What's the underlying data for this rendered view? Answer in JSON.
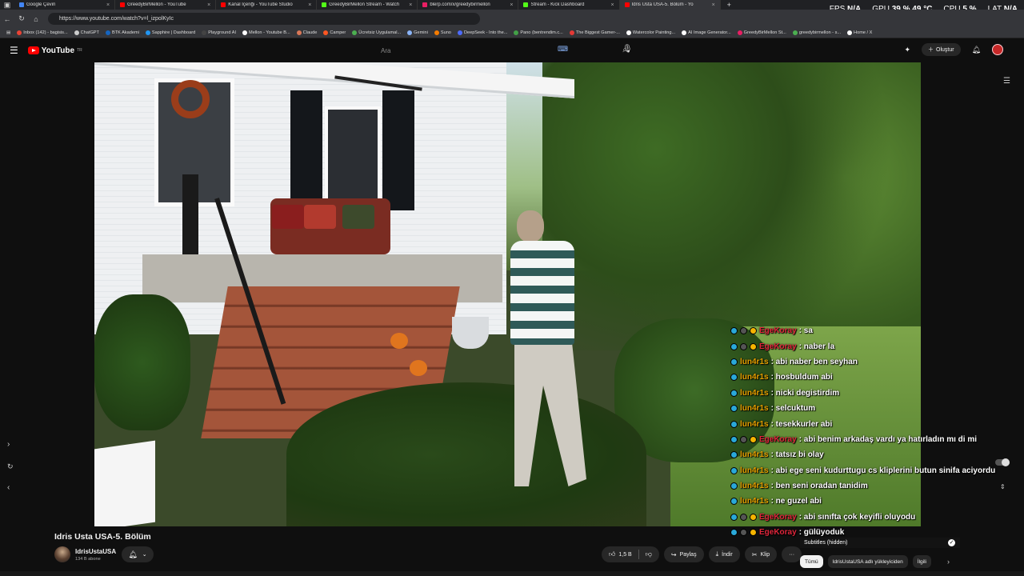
{
  "browser": {
    "tabs": [
      {
        "label": "Google Çeviri",
        "color": "#4285f4"
      },
      {
        "label": "GreedyBirMellon - YouTube",
        "color": "#ff0000"
      },
      {
        "label": "Kanal İçeriği - YouTube Studio",
        "color": "#ff0000"
      },
      {
        "label": "GreedyBirMellon Stream - Watch",
        "color": "#53fc18"
      },
      {
        "label": "blerp.com/x/greedybirmellon",
        "color": "#e91e63"
      },
      {
        "label": "Stream - Kick Dashboard",
        "color": "#53fc18"
      },
      {
        "label": "Idris Usta USA-5. Bölüm - Yo",
        "color": "#ff0000"
      }
    ],
    "url": "https://www.youtube.com/watch?v=l_izpolKyIc",
    "bookmarks": [
      {
        "label": "Inbox (142) - bagisis...",
        "color": "#ea4335"
      },
      {
        "label": "ChatGPT",
        "color": "#cccccc"
      },
      {
        "label": "BTK Akademi",
        "color": "#1565c0"
      },
      {
        "label": "Sapphire | Dashboard",
        "color": "#2196f3"
      },
      {
        "label": "Playground AI",
        "color": "#444444"
      },
      {
        "label": "Mellon - Youtube B...",
        "color": "#ffffff"
      },
      {
        "label": "Claude",
        "color": "#d97757"
      },
      {
        "label": "Camper",
        "color": "#ff5722"
      },
      {
        "label": "Ücretsiz Uygulamal...",
        "color": "#4caf50"
      },
      {
        "label": "Gemini",
        "color": "#8ab4f8"
      },
      {
        "label": "Suno",
        "color": "#f57c00"
      },
      {
        "label": "DeepSeek - Into the...",
        "color": "#4d6bfe"
      },
      {
        "label": "Pano (bentrendim.c...",
        "color": "#43a047"
      },
      {
        "label": "The Biggest Gamer-...",
        "color": "#e53935"
      },
      {
        "label": "Watercolor Painting...",
        "color": "#ffffff"
      },
      {
        "label": "AI Image Generator...",
        "color": "#ffffff"
      },
      {
        "label": "GreedyBirMellon St...",
        "color": "#e91e63"
      },
      {
        "label": "greedybirmellon - s...",
        "color": "#4caf50"
      },
      {
        "label": "Home / X",
        "color": "#ffffff"
      }
    ]
  },
  "system": {
    "fps_label": "FPS",
    "fps_value": "N/A",
    "gpu_label": "GPU",
    "gpu_value": "39 %",
    "gpu_temp": "49 °C",
    "cpu_label": "CPU",
    "cpu_value": "5 %",
    "lat_label": "LAT",
    "lat_value": "N/A"
  },
  "youtube": {
    "logo_text": "YouTube",
    "logo_region": "TR",
    "search_placeholder": "Ara",
    "create_label": "Oluştur"
  },
  "chat": [
    {
      "user": "EgeKoray",
      "text": ": sa",
      "color": "#e0263b",
      "badges": 3
    },
    {
      "user": "EgeKoray",
      "text": ": naber la",
      "color": "#e0263b",
      "badges": 3
    },
    {
      "user": "lun4r1s",
      "text": ": abi naber ben seyhan",
      "color": "#e6a100",
      "badges": 0
    },
    {
      "user": "lun4r1s",
      "text": ": hosbuldum abi",
      "color": "#e6a100",
      "badges": 0
    },
    {
      "user": "lun4r1s",
      "text": ": nicki degistirdim",
      "color": "#e6a100",
      "badges": 0
    },
    {
      "user": "lun4r1s",
      "text": ": selcuktum",
      "color": "#e6a100",
      "badges": 0
    },
    {
      "user": "lun4r1s",
      "text": ": tesekkurler abi",
      "color": "#e6a100",
      "badges": 0
    },
    {
      "user": "EgeKoray",
      "text": ": abi benim arkadaş vardı ya hatırladın mı di mi",
      "color": "#e0263b",
      "badges": 3
    },
    {
      "user": "lun4r1s",
      "text": ": tatsız bi olay",
      "color": "#e6a100",
      "badges": 0
    },
    {
      "user": "lun4r1s",
      "text": ": abi ege seni kudurttugu cs kliplerini butun sinifa aciyordu",
      "color": "#e6a100",
      "badges": 0
    },
    {
      "user": "lun4r1s",
      "text": ": ben seni oradan tanidim",
      "color": "#e6a100",
      "badges": 0
    },
    {
      "user": "lun4r1s",
      "text": ": ne guzel abi",
      "color": "#e6a100",
      "badges": 0
    },
    {
      "user": "EgeKoray",
      "text": ": abi sınıfta çok keyifli oluyodu",
      "color": "#e0263b",
      "badges": 3
    },
    {
      "user": "EgeKoray",
      "text": ": gülüyoduk",
      "color": "#e0263b",
      "badges": 3
    }
  ],
  "subtitles_label": "Subtitles (hidden)",
  "video": {
    "title": "Idris Usta USA-5. Bölüm",
    "channel": "IdrisUstaUSA",
    "subscribers": "134 B abone",
    "likes": "1,5 B",
    "share_label": "Paylaş",
    "download_label": "İndir",
    "clip_label": "Klip",
    "more_label": "···"
  },
  "chips": [
    {
      "label": "Tümü",
      "active": true
    },
    {
      "label": "IdrisUstaUSA adlı yükleyiciden",
      "active": false
    },
    {
      "label": "İlgili",
      "active": false
    }
  ]
}
